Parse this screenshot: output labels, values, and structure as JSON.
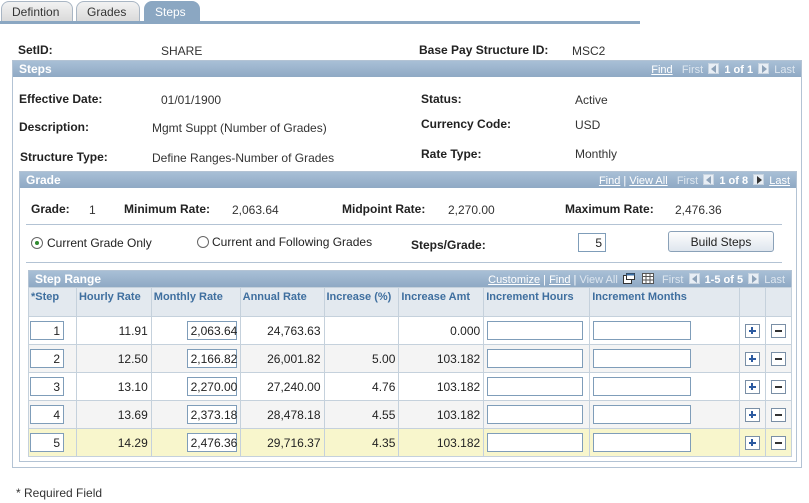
{
  "tabs": [
    {
      "label": "Defintion"
    },
    {
      "label": "Grades"
    },
    {
      "label": "Steps"
    }
  ],
  "top": {
    "setid_label": "SetID:",
    "setid_value": "SHARE",
    "bps_label": "Base Pay Structure ID:",
    "bps_value": "MSC2"
  },
  "steps_box": {
    "title": "Steps",
    "nav_find": "Find",
    "nav_first": "First",
    "nav_count": "1 of 1",
    "nav_last": "Last",
    "effective_date_label": "Effective Date:",
    "effective_date_value": "01/01/1900",
    "status_label": "Status:",
    "status_value": "Active",
    "description_label": "Description:",
    "description_value": "Mgmt Suppt (Number of Grades)",
    "currency_label": "Currency Code:",
    "currency_value": "USD",
    "structure_type_label": "Structure Type:",
    "structure_type_value": "Define Ranges-Number of Grades",
    "rate_type_label": "Rate Type:",
    "rate_type_value": "Monthly"
  },
  "grade_box": {
    "title": "Grade",
    "nav_find": "Find",
    "nav_sep": "|",
    "nav_view_all": "View All",
    "nav_first": "First",
    "nav_count": "1 of 8",
    "nav_last": "Last",
    "grade_label": "Grade:",
    "grade_value": "1",
    "min_label": "Minimum Rate:",
    "min_value": "2,063.64",
    "mid_label": "Midpoint Rate:",
    "mid_value": "2,270.00",
    "max_label": "Maximum Rate:",
    "max_value": "2,476.36",
    "radio_current_only": "Current Grade Only",
    "radio_current_following": "Current and Following Grades",
    "steps_per_grade_label": "Steps/Grade:",
    "steps_per_grade_value": "5",
    "build_steps_button": "Build Steps"
  },
  "step_range": {
    "title": "Step Range",
    "nav_customize": "Customize",
    "nav_sep": "|",
    "nav_find": "Find",
    "nav_view_all": "View All",
    "nav_first": "First",
    "nav_count": "1-5 of 5",
    "nav_last": "Last",
    "columns": {
      "step": "*Step",
      "hourly": "Hourly Rate",
      "monthly": "Monthly Rate",
      "annual": "Annual Rate",
      "increase_pct": "Increase (%)",
      "increase_amt": "Increase Amt",
      "inc_hours": "Increment Hours",
      "inc_months": "Increment Months"
    },
    "rows": [
      {
        "step": "1",
        "hourly": "11.91",
        "monthly": "2,063.64",
        "annual": "24,763.63",
        "increase_pct": "",
        "increase_amt": "0.000"
      },
      {
        "step": "2",
        "hourly": "12.50",
        "monthly": "2,166.82",
        "annual": "26,001.82",
        "increase_pct": "5.00",
        "increase_amt": "103.182"
      },
      {
        "step": "3",
        "hourly": "13.10",
        "monthly": "2,270.00",
        "annual": "27,240.00",
        "increase_pct": "4.76",
        "increase_amt": "103.182"
      },
      {
        "step": "4",
        "hourly": "13.69",
        "monthly": "2,373.18",
        "annual": "28,478.18",
        "increase_pct": "4.55",
        "increase_amt": "103.182"
      },
      {
        "step": "5",
        "hourly": "14.29",
        "monthly": "2,476.36",
        "annual": "29,716.37",
        "increase_pct": "4.35",
        "increase_amt": "103.182"
      }
    ]
  },
  "footer": {
    "required_note": "* Required Field"
  },
  "colors": {
    "header_blue": "#8fa9c4",
    "column_header_text": "#3f6f9f",
    "selected_row": "#f8f6cc"
  }
}
